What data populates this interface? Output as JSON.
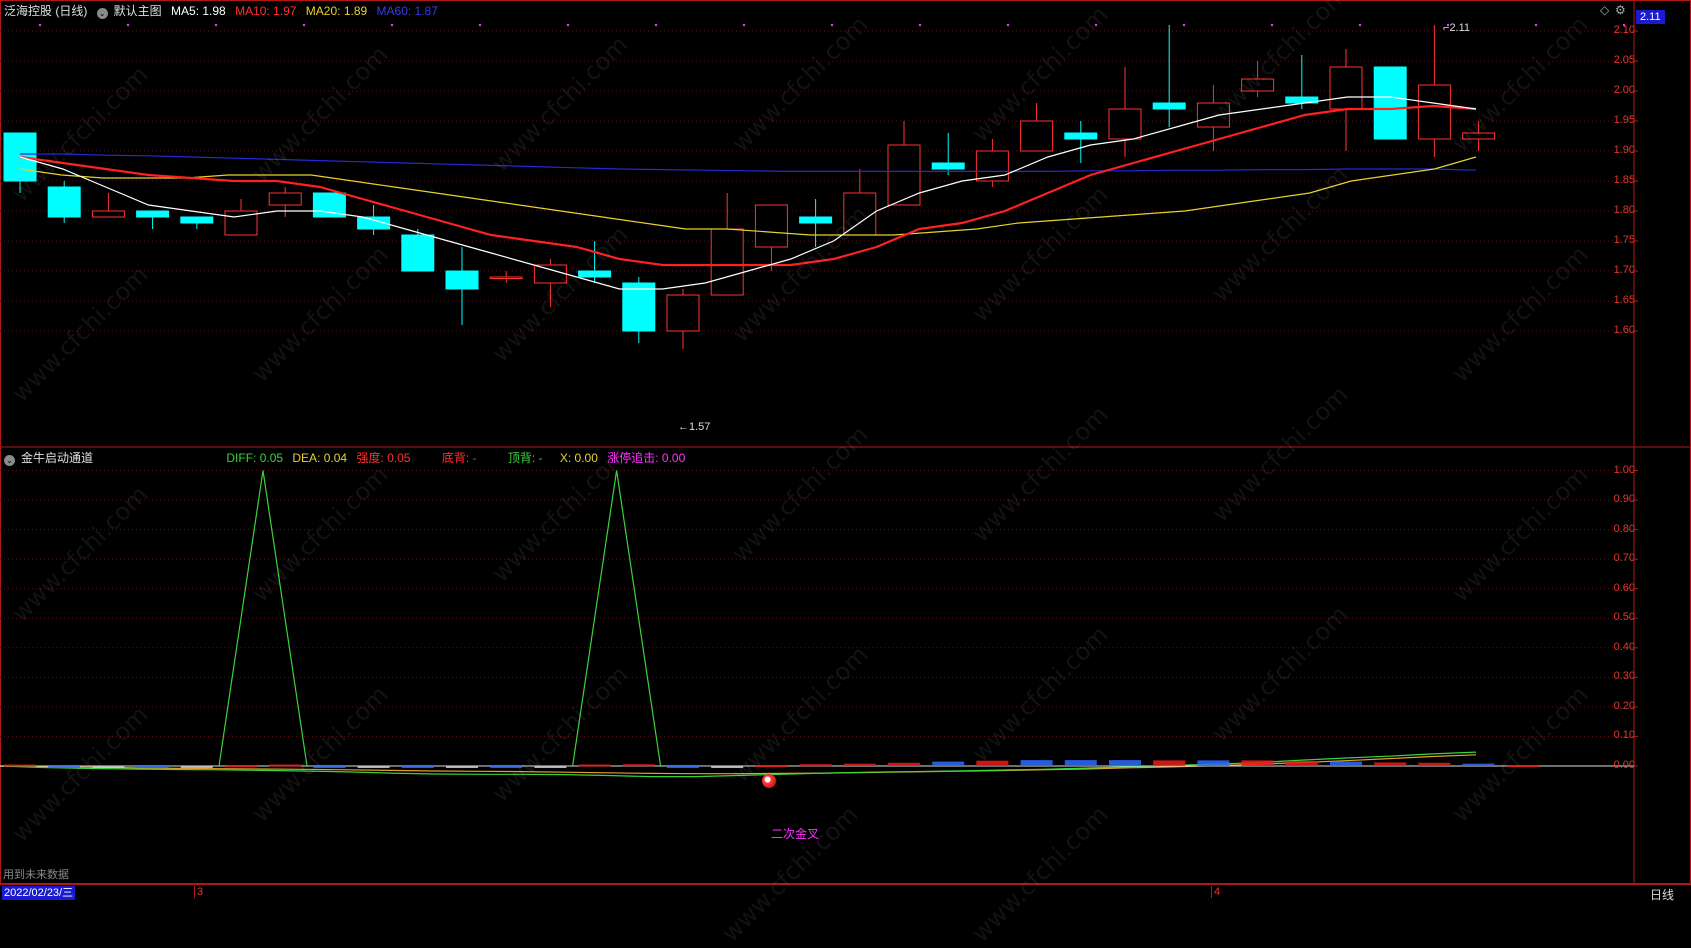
{
  "main_header": {
    "stock_name": "泛海控股 (日线)",
    "chart_name": "默认主图",
    "ma5": "MA5: 1.98",
    "ma10": "MA10: 1.97",
    "ma20": "MA20: 1.89",
    "ma60": "MA60: 1.87"
  },
  "price_box": "2.11",
  "main_axis": [
    "2.10",
    "2.05",
    "2.00",
    "1.95",
    "1.90",
    "1.85",
    "1.80",
    "1.75",
    "1.70",
    "1.65",
    "1.60"
  ],
  "high_label": "2.11",
  "low_label": "←1.57",
  "indicator_header": {
    "name": "金牛启动通道",
    "diff": "DIFF: 0.05",
    "dea": "DEA: 0.04",
    "strength": "强度: 0.05",
    "bottom_div": "底背: -",
    "top_div": "顶背: -",
    "x_val": "X: 0.00",
    "limit_up": "涨停追击: 0.00"
  },
  "indicator_axis": [
    "1.00",
    "0.90",
    "0.80",
    "0.70",
    "0.60",
    "0.50",
    "0.40",
    "0.30",
    "0.20",
    "0.10",
    "0.00"
  ],
  "signal_label": "二次金叉",
  "future_data_note": "用到未来数据",
  "bottom_bar": {
    "date": "2022/02/23/三",
    "month3": "3",
    "month4": "4",
    "period": "日线"
  },
  "watermark": "www.cfchi.com",
  "colors": {
    "up": "#ff3232",
    "down": "#00ffff",
    "ma5": "#ffffff",
    "ma10": "#ff2020",
    "ma20": "#e6d22e",
    "ma60": "#2828d2",
    "axis": "#b01818",
    "diff": "#3cd23c",
    "magenta": "#ff30ff"
  },
  "chart_data": {
    "type": "candlestick",
    "ohlc": [
      [
        1.93,
        1.93,
        1.83,
        1.85
      ],
      [
        1.84,
        1.85,
        1.78,
        1.79
      ],
      [
        1.79,
        1.83,
        1.79,
        1.8
      ],
      [
        1.8,
        1.8,
        1.77,
        1.79
      ],
      [
        1.79,
        1.79,
        1.77,
        1.78
      ],
      [
        1.76,
        1.82,
        1.76,
        1.8
      ],
      [
        1.81,
        1.84,
        1.79,
        1.83
      ],
      [
        1.83,
        1.83,
        1.8,
        1.79
      ],
      [
        1.79,
        1.81,
        1.76,
        1.77
      ],
      [
        1.76,
        1.77,
        1.7,
        1.7
      ],
      [
        1.7,
        1.74,
        1.61,
        1.67
      ],
      [
        1.69,
        1.7,
        1.68,
        1.69
      ],
      [
        1.68,
        1.72,
        1.64,
        1.71
      ],
      [
        1.7,
        1.75,
        1.68,
        1.69
      ],
      [
        1.68,
        1.69,
        1.58,
        1.6
      ],
      [
        1.6,
        1.67,
        1.57,
        1.66
      ],
      [
        1.66,
        1.83,
        1.66,
        1.77
      ],
      [
        1.74,
        1.81,
        1.7,
        1.81
      ],
      [
        1.79,
        1.82,
        1.74,
        1.78
      ],
      [
        1.76,
        1.87,
        1.76,
        1.83
      ],
      [
        1.81,
        1.95,
        1.81,
        1.91
      ],
      [
        1.88,
        1.93,
        1.86,
        1.87
      ],
      [
        1.85,
        1.92,
        1.84,
        1.9
      ],
      [
        1.9,
        1.98,
        1.9,
        1.95
      ],
      [
        1.93,
        1.95,
        1.88,
        1.92
      ],
      [
        1.92,
        2.04,
        1.89,
        1.97
      ],
      [
        1.98,
        2.11,
        1.94,
        1.97
      ],
      [
        1.94,
        2.01,
        1.9,
        1.98
      ],
      [
        2.0,
        2.05,
        1.99,
        2.02
      ],
      [
        1.99,
        2.06,
        1.97,
        1.98
      ],
      [
        1.97,
        2.07,
        1.9,
        2.04
      ],
      [
        2.04,
        2.04,
        1.92,
        1.92
      ],
      [
        1.92,
        2.11,
        1.89,
        2.01
      ],
      [
        1.92,
        1.95,
        1.9,
        1.93
      ]
    ],
    "ma5": [
      1.89,
      1.87,
      1.84,
      1.81,
      1.8,
      1.79,
      1.8,
      1.8,
      1.79,
      1.77,
      1.75,
      1.73,
      1.71,
      1.69,
      1.67,
      1.67,
      1.68,
      1.7,
      1.72,
      1.75,
      1.8,
      1.83,
      1.85,
      1.86,
      1.89,
      1.91,
      1.92,
      1.94,
      1.96,
      1.97,
      1.98,
      1.99,
      1.99,
      1.98,
      1.97
    ],
    "ma10": [
      1.89,
      1.88,
      1.87,
      1.86,
      1.855,
      1.85,
      1.85,
      1.84,
      1.82,
      1.8,
      1.78,
      1.76,
      1.75,
      1.74,
      1.72,
      1.71,
      1.71,
      1.71,
      1.71,
      1.72,
      1.74,
      1.77,
      1.78,
      1.8,
      1.83,
      1.86,
      1.88,
      1.9,
      1.92,
      1.94,
      1.96,
      1.97,
      1.97,
      1.975,
      1.97
    ],
    "ma20": [
      1.87,
      1.86,
      1.855,
      1.855,
      1.855,
      1.86,
      1.86,
      1.86,
      1.85,
      1.84,
      1.83,
      1.82,
      1.81,
      1.8,
      1.79,
      1.78,
      1.77,
      1.77,
      1.765,
      1.76,
      1.76,
      1.76,
      1.765,
      1.77,
      1.78,
      1.785,
      1.79,
      1.795,
      1.8,
      1.81,
      1.82,
      1.83,
      1.85,
      1.86,
      1.87,
      1.89
    ],
    "ma60": [
      1.895,
      1.895,
      1.893,
      1.892,
      1.89,
      1.888,
      1.886,
      1.884,
      1.882,
      1.88,
      1.878,
      1.876,
      1.874,
      1.872,
      1.87,
      1.869,
      1.868,
      1.867,
      1.866,
      1.866,
      1.866,
      1.866,
      1.866,
      1.866,
      1.866,
      1.867,
      1.867,
      1.868,
      1.868,
      1.869,
      1.869,
      1.87,
      1.87,
      1.87,
      1.868
    ],
    "indicator": {
      "spikes": [
        5,
        13
      ],
      "bars": [
        0.005,
        -0.005,
        -0.006,
        -0.005,
        -0.004,
        0.003,
        0.005,
        -0.004,
        -0.005,
        -0.004,
        -0.004,
        -0.006,
        -0.003,
        0.005,
        0.006,
        -0.006,
        -0.002,
        0.003,
        0.006,
        0.008,
        0.011,
        0.015,
        0.018,
        0.02,
        0.02,
        0.02,
        0.019,
        0.019,
        0.019,
        0.017,
        0.015,
        0.012,
        0.011,
        0.008,
        0.003
      ],
      "diff": [
        0.0,
        -0.005,
        -0.008,
        -0.01,
        -0.012,
        -0.013,
        -0.015,
        -0.017,
        -0.02,
        -0.024,
        -0.027,
        -0.028,
        -0.028,
        -0.029,
        -0.032,
        -0.036,
        -0.036,
        -0.032,
        -0.028,
        -0.024,
        -0.021,
        -0.019,
        -0.017,
        -0.014,
        -0.011,
        -0.007,
        -0.003,
        0.002,
        0.006,
        0.012,
        0.02,
        0.027,
        0.033,
        0.041,
        0.047
      ],
      "dea": [
        0.0,
        -0.002,
        -0.004,
        -0.006,
        -0.008,
        -0.009,
        -0.01,
        -0.011,
        -0.013,
        -0.015,
        -0.017,
        -0.018,
        -0.019,
        -0.021,
        -0.023,
        -0.025,
        -0.026,
        -0.026,
        -0.025,
        -0.024,
        -0.022,
        -0.02,
        -0.018,
        -0.016,
        -0.013,
        -0.01,
        -0.006,
        -0.003,
        0.001,
        0.006,
        0.012,
        0.018,
        0.025,
        0.032,
        0.038
      ],
      "ylim": [
        -0.1,
        1.05
      ]
    }
  }
}
